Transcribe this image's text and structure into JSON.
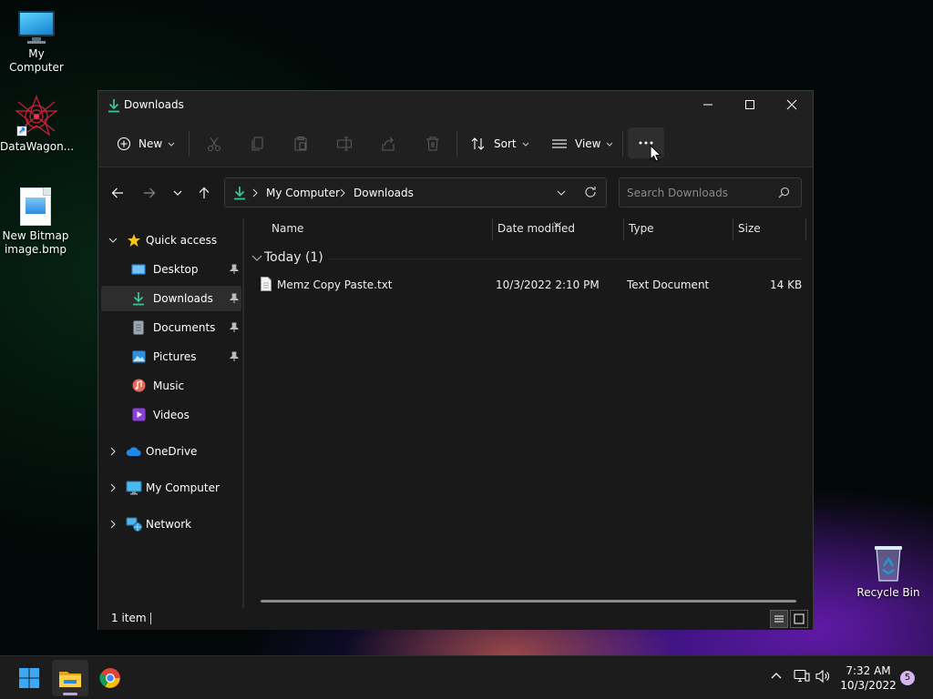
{
  "desktop": {
    "icons": [
      {
        "label": "My Computer",
        "icon": "monitor-icon"
      },
      {
        "label": "DataWagon...",
        "icon": "datawagon-icon"
      },
      {
        "label": "New Bitmap image.bmp",
        "icon": "bitmap-file-icon"
      },
      {
        "label": "Recycle Bin",
        "icon": "recycle-bin-icon"
      }
    ]
  },
  "window": {
    "title": "Downloads",
    "toolbar": {
      "new_label": "New",
      "sort_label": "Sort",
      "view_label": "View"
    },
    "address": {
      "crumbs": [
        "My Computer",
        "Downloads"
      ]
    },
    "search": {
      "placeholder": "Search Downloads"
    },
    "sidebar": {
      "quick_access": "Quick access",
      "items": [
        {
          "label": "Desktop",
          "icon": "desktop-folder-icon",
          "pinned": true
        },
        {
          "label": "Downloads",
          "icon": "downloads-icon",
          "pinned": true,
          "selected": true
        },
        {
          "label": "Documents",
          "icon": "documents-icon",
          "pinned": true
        },
        {
          "label": "Pictures",
          "icon": "pictures-icon",
          "pinned": true
        },
        {
          "label": "Music",
          "icon": "music-icon",
          "pinned": false
        },
        {
          "label": "Videos",
          "icon": "videos-icon",
          "pinned": false
        }
      ],
      "roots": [
        {
          "label": "OneDrive",
          "icon": "onedrive-icon"
        },
        {
          "label": "My Computer",
          "icon": "monitor-icon"
        },
        {
          "label": "Network",
          "icon": "network-icon"
        }
      ]
    },
    "columns": [
      "Name",
      "Date modified",
      "Type",
      "Size"
    ],
    "group": "Today (1)",
    "files": [
      {
        "name": "Memz Copy Paste.txt",
        "date": "10/3/2022 2:10 PM",
        "type": "Text Document",
        "size": "14 KB"
      }
    ],
    "status": "1 item"
  },
  "taskbar": {
    "apps": [
      "start-icon",
      "file-explorer-icon",
      "chrome-icon"
    ],
    "time": "7:32 AM",
    "date": "10/3/2022",
    "notifications": "5"
  },
  "colors": {
    "accent_green": "#3ec28f",
    "window_bg": "#191919",
    "toolbar_bg": "#202020",
    "taskbar_bg": "#1c1c1c"
  }
}
